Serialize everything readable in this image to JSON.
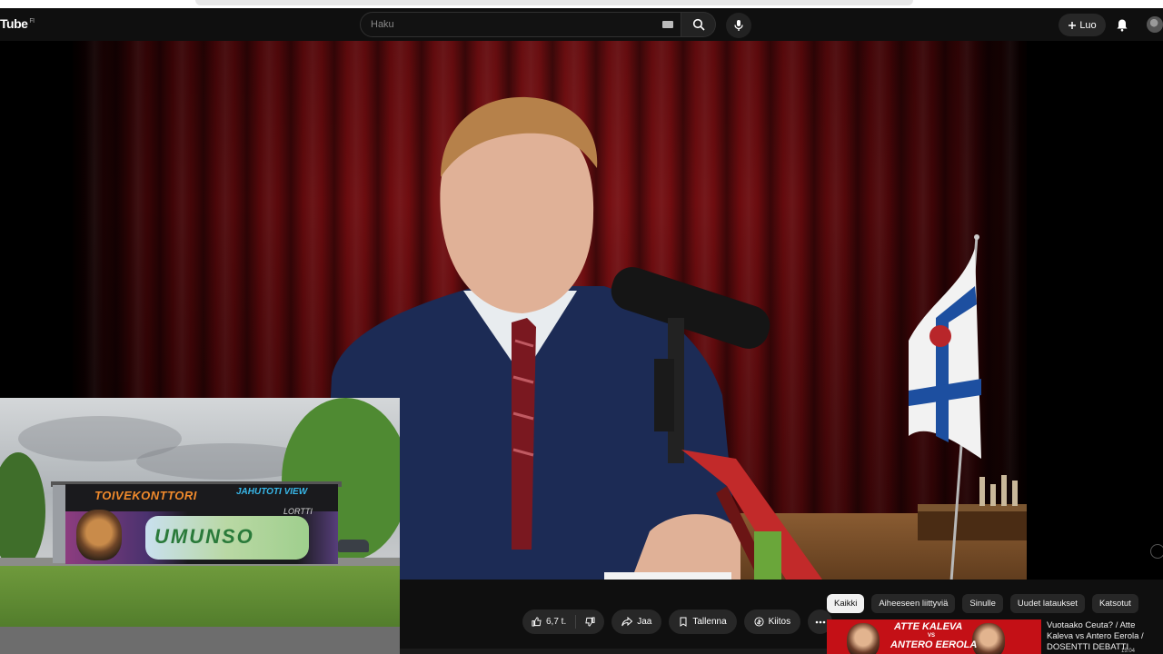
{
  "header": {
    "logo_text": "Tube",
    "country_code": "FI",
    "search_placeholder": "Haku",
    "create_label": "Luo",
    "icons": [
      "keyboard-icon",
      "search-icon",
      "microphone-icon",
      "plus-icon",
      "bell-icon",
      "avatar"
    ]
  },
  "pip_overlay": {
    "graffiti_title": "TOIVEKONTTORI",
    "graffiti_tag": "JAHUTOTI VIEW",
    "graffiti_tag2": "LORTTI",
    "graffiti_main": "UMUNSO"
  },
  "actions": {
    "like_count": "6,7 t.",
    "share_label": "Jaa",
    "save_label": "Tallenna",
    "thanks_label": "Kiitos"
  },
  "chips": [
    "Kaikki",
    "Aiheeseen liittyviä",
    "Sinulle",
    "Uudet lataukset",
    "Katsotut"
  ],
  "active_chip": "Kaikki",
  "recommendation": {
    "thumb_line1": "ATTE KALEVA",
    "thumb_vs": "VS",
    "thumb_line2": "ANTERO EEROLA",
    "title": "Vuotaako Ceuta? / Atte Kaleva vs Antero Eerola / DOSENTTI DEBATTI",
    "duration": "15:04"
  },
  "colors": {
    "background": "#0f0f0f",
    "chip_active": "#f1f1f1",
    "button_bg": "#272727",
    "thumb_red": "#c41016"
  }
}
